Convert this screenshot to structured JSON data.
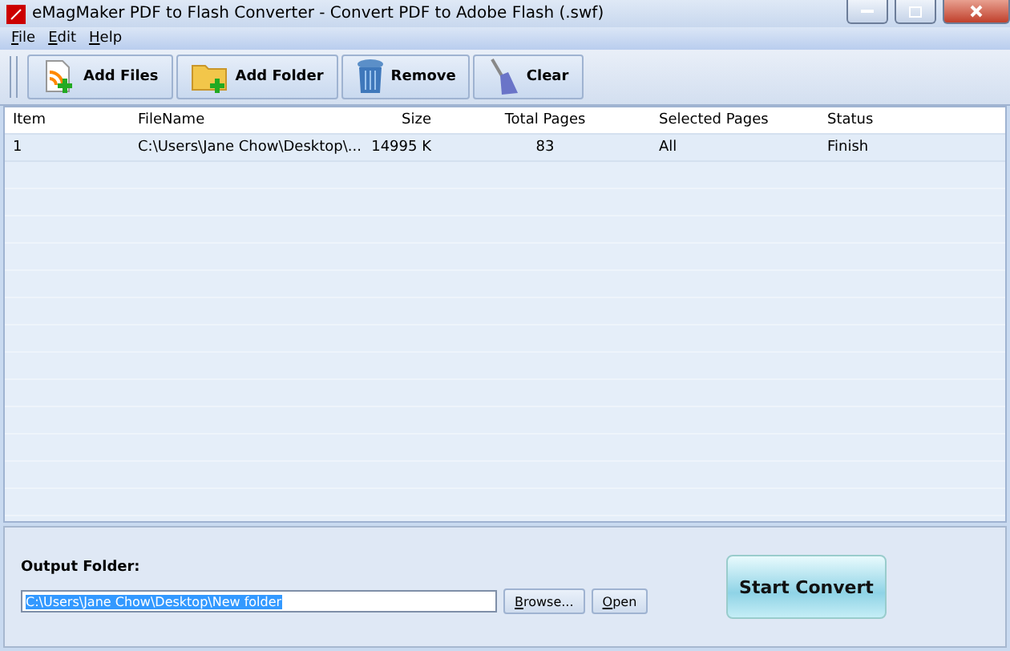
{
  "window": {
    "title": "eMagMaker PDF to Flash Converter - Convert PDF to Adobe Flash (.swf)"
  },
  "menu": [
    "File",
    "Edit",
    "Help"
  ],
  "toolbar": [
    {
      "label": "Add Files",
      "kind": "add-files"
    },
    {
      "label": "Add Folder",
      "kind": "add-folder"
    },
    {
      "label": "Remove",
      "kind": "remove"
    },
    {
      "label": "Clear",
      "kind": "clear"
    }
  ],
  "table": {
    "columns": [
      "Item",
      "FileName",
      "Size",
      "Total Pages",
      "Selected Pages",
      "Status"
    ],
    "rows": [
      [
        "1",
        "C:\\Users\\Jane Chow\\Desktop\\...",
        "14995 K",
        "83",
        "All",
        "Finish"
      ]
    ]
  },
  "output": {
    "label": "Output Folder:",
    "value": "C:\\Users\\Jane Chow\\Desktop\\New folder",
    "buttons": [
      "Browse...",
      "Open"
    ]
  },
  "start_button": "Start Convert"
}
